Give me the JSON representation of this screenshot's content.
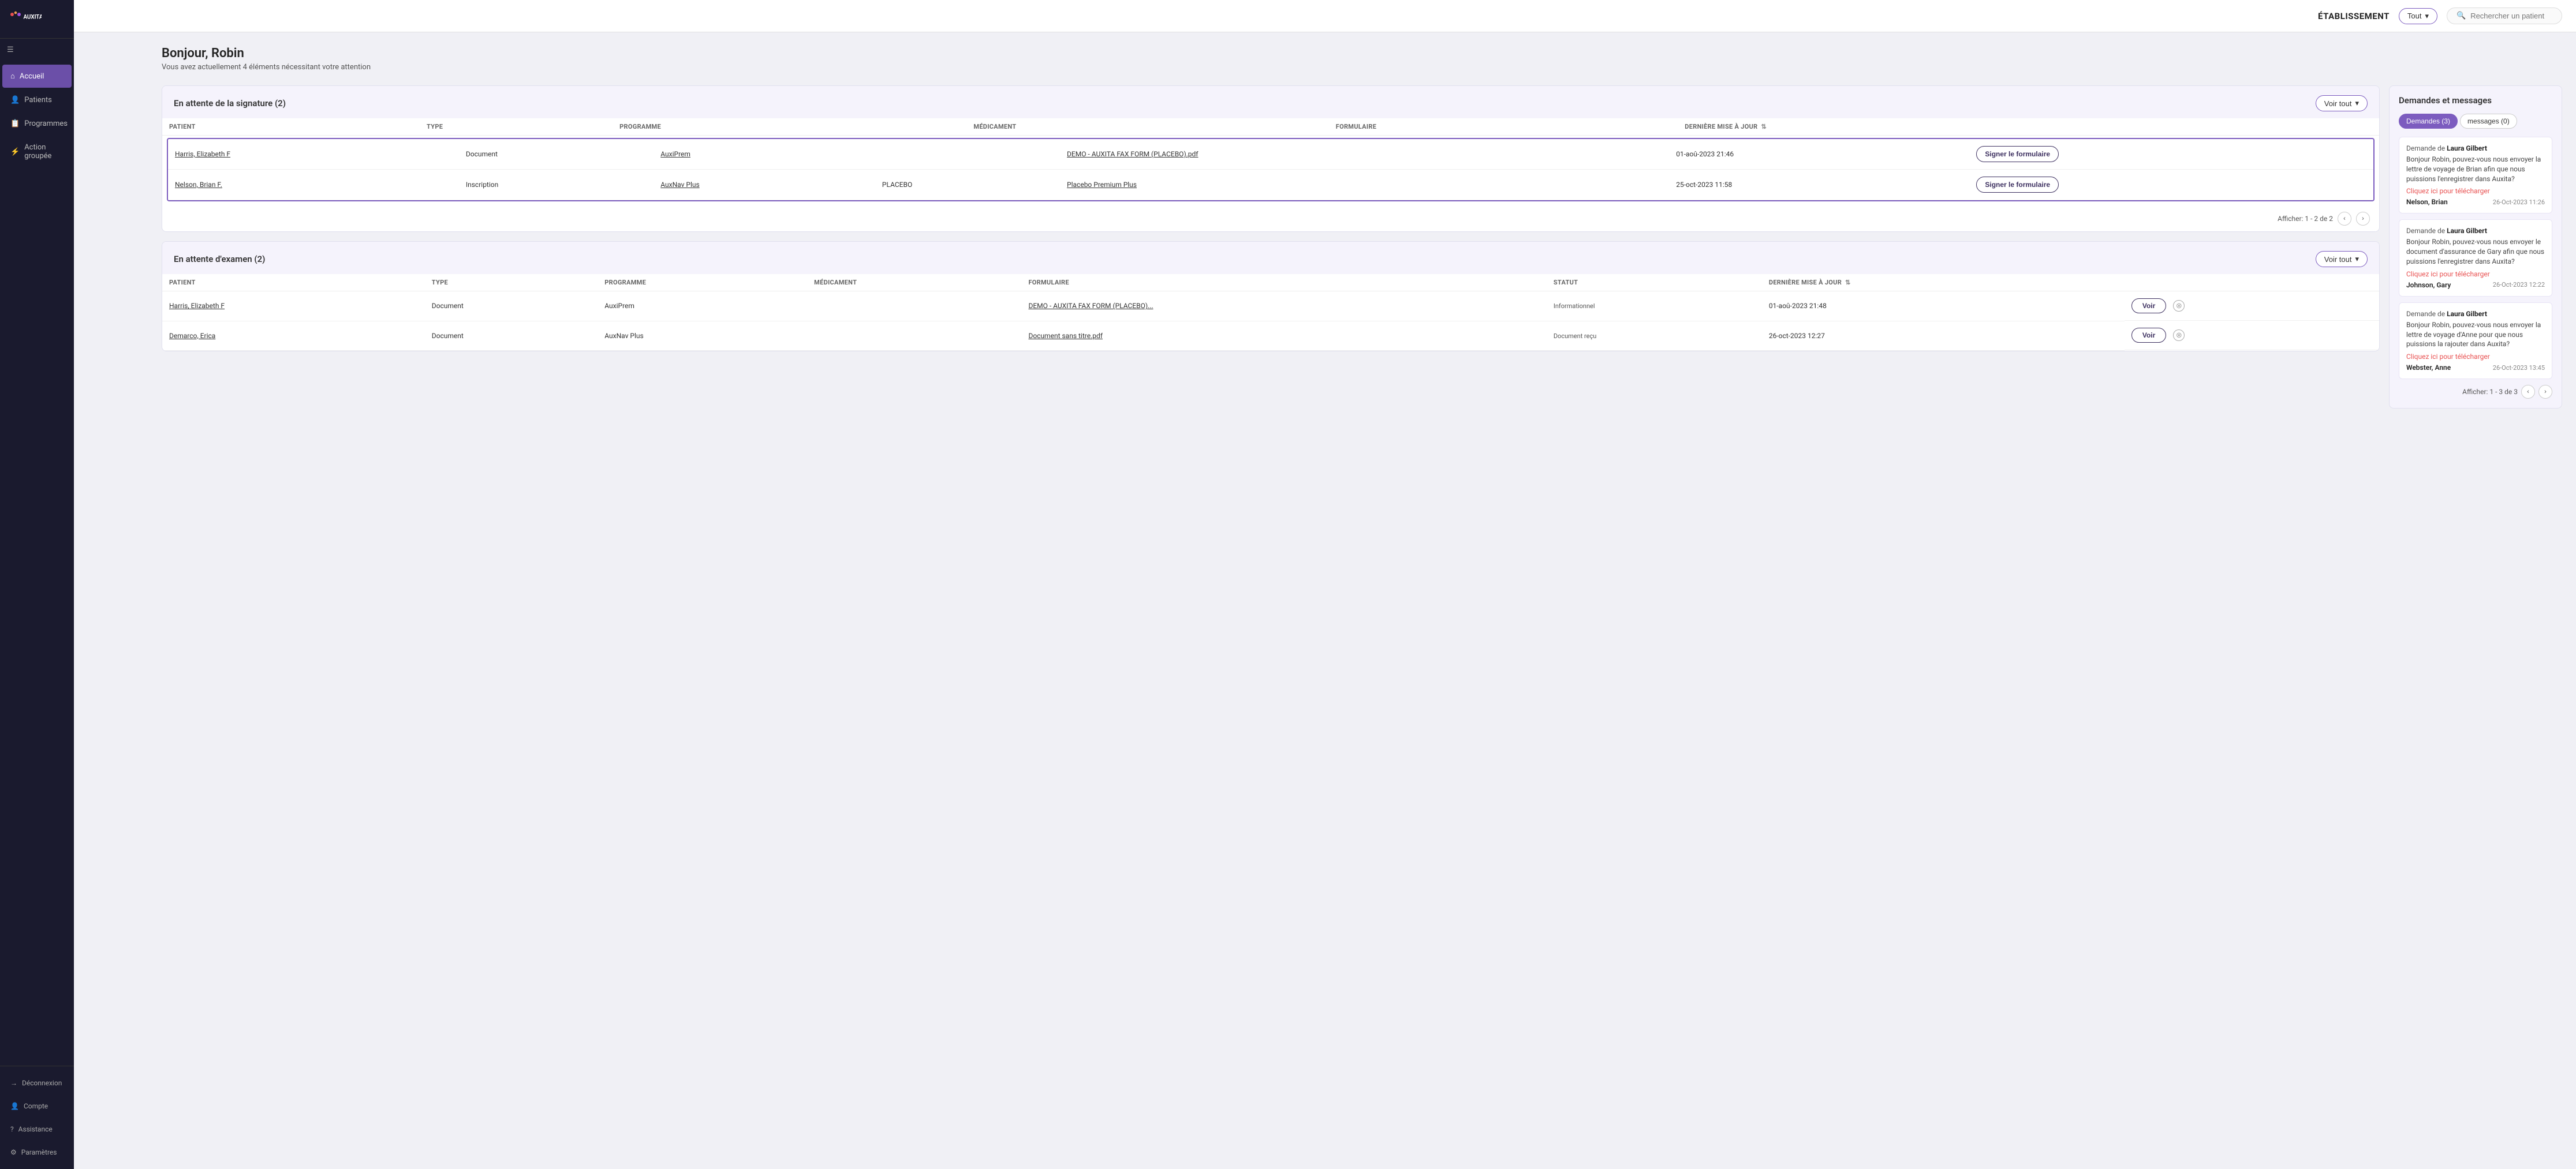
{
  "app": {
    "logo_text": "AUXITA"
  },
  "topbar": {
    "etablissement_label": "ÉTABLISSEMENT",
    "dropdown_value": "Tout",
    "search_placeholder": "Rechercher un patient"
  },
  "sidebar": {
    "toggle_icon": "☰",
    "items": [
      {
        "id": "accueil",
        "label": "Accueil",
        "icon": "⌂",
        "active": true
      },
      {
        "id": "patients",
        "label": "Patients",
        "icon": "👤",
        "active": false
      },
      {
        "id": "programmes",
        "label": "Programmes",
        "icon": "📋",
        "active": false
      },
      {
        "id": "action-groupee",
        "label": "Action groupée",
        "icon": "⚡",
        "active": false
      }
    ],
    "bottom_items": [
      {
        "id": "deconnexion",
        "label": "Déconnexion",
        "icon": "→"
      },
      {
        "id": "compte",
        "label": "Compte",
        "icon": "👤"
      },
      {
        "id": "assistance",
        "label": "Assistance",
        "icon": "?"
      },
      {
        "id": "parametres",
        "label": "Paramètres",
        "icon": "⚙"
      }
    ]
  },
  "welcome": {
    "title": "Bonjour, Robin",
    "subtitle": "Vous avez actuellement 4 éléments nécessitant votre attention"
  },
  "signature_section": {
    "title": "En attente de la signature (2)",
    "voir_tout_label": "Voir tout",
    "columns": [
      "PATIENT",
      "TYPE",
      "PROGRAMME",
      "MÉDICAMENT",
      "FORMULAIRE",
      "DERNIÈRE MISE À JOUR"
    ],
    "rows": [
      {
        "patient": "Harris, Elizabeth F",
        "type": "Document",
        "programme": "AuxiPrem",
        "medicament": "",
        "formulaire": "DEMO - AUXITA FAX FORM (PLACEBO).pdf",
        "date": "01-aoû-2023 21:46",
        "action": "Signer le formulaire"
      },
      {
        "patient": "Nelson, Brian F.",
        "type": "Inscription",
        "programme": "AuxNav Plus",
        "medicament": "PLACEBO",
        "formulaire": "Placebo Premium Plus",
        "date": "25-oct-2023 11:58",
        "action": "Signer le formulaire"
      }
    ],
    "pagination": "Afficher: 1 - 2 de 2"
  },
  "examen_section": {
    "title": "En attente d'examen (2)",
    "voir_tout_label": "Voir tout",
    "columns": [
      "PATIENT",
      "TYPE",
      "PROGRAMME",
      "MÉDICAMENT",
      "FORMULAIRE",
      "STATUT",
      "DERNIÈRE MISE À JOUR"
    ],
    "rows": [
      {
        "patient": "Harris, Elizabeth F",
        "type": "Document",
        "programme": "AuxiPrem",
        "medicament": "",
        "formulaire": "DEMO - AUXITA FAX FORM (PLACEBO)...",
        "statut": "Informationnel",
        "date": "01-aoû-2023 21:48",
        "action": "Voir"
      },
      {
        "patient": "Demarco, Erica",
        "type": "Document",
        "programme": "AuxNav Plus",
        "medicament": "",
        "formulaire": "Document sans titre.pdf",
        "statut": "Document reçu",
        "date": "26-oct-2023 12:27",
        "action": "Voir"
      }
    ]
  },
  "requests_panel": {
    "title": "Demandes et messages",
    "tabs": [
      {
        "label": "Demandes (3)",
        "active": true
      },
      {
        "label": "messages (0)",
        "active": false
      }
    ],
    "requests": [
      {
        "from_label": "Demande de",
        "from_name": "Laura Gilbert",
        "body": "Bonjour Robin, pouvez-vous nous envoyer la lettre de voyage de Brian afin que nous puissions l'enregistrer dans Auxita?",
        "download_text": "Cliquez ici pour télécharger",
        "patient": "Nelson, Brian",
        "date": "26-Oct-2023 11:26"
      },
      {
        "from_label": "Demande de",
        "from_name": "Laura Gilbert",
        "body": "Bonjour Robin, pouvez-vous nous envoyer le document d'assurance de Gary afin que nous puissions l'enregistrer dans Auxita?",
        "download_text": "Cliquez ici pour télécharger",
        "patient": "Johnson, Gary",
        "date": "26-Oct-2023 12:22"
      },
      {
        "from_label": "Demande de",
        "from_name": "Laura Gilbert",
        "body": "Bonjour Robin, pouvez-vous nous envoyer la lettre de voyage d'Anne pour que nous puissions la rajouter dans Auxita?",
        "download_text": "Cliquez ici pour télécharger",
        "patient": "Webster, Anne",
        "date": "26-Oct-2023 13:45"
      }
    ],
    "pagination": "Afficher: 1 - 3 de 3"
  }
}
